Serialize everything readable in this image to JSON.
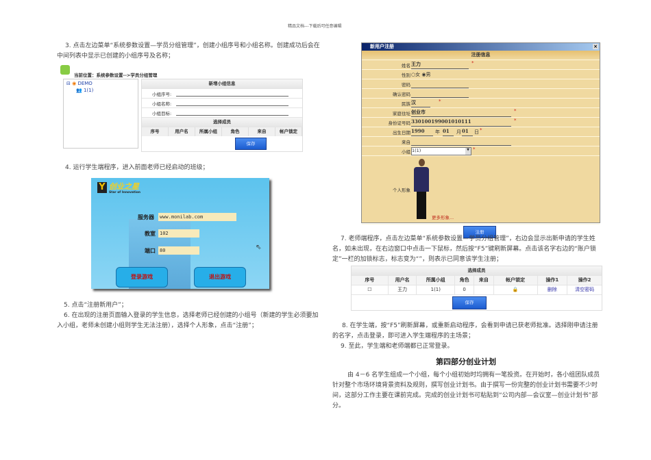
{
  "header": "精品文档---下载后可任意编辑",
  "left": {
    "para3": "3. 点击左边菜单“系统参数设置—学员分组管理”，创建小组序号和小组名称。创建成功后会在中间列表中显示已创建的小组序号及名称；",
    "shot1": {
      "location": "当前位置：系统参数设置-->学员分组管理",
      "tree_root": "DEMO",
      "tree_child": "1(1)",
      "form_title": "新增小组信息",
      "fields": [
        "小组序号:",
        "小组名称:",
        "小组目标:"
      ],
      "members_title": "选择成员",
      "columns": [
        "序号",
        "用户名",
        "所属小组",
        "角色",
        "来自",
        "帐户锁定"
      ],
      "save": "保存"
    },
    "para4": "4. 运行学生端程序，进入前面老师已经启动的班级；",
    "login": {
      "logo_cn": "创业之星",
      "logo_en": "Star of Innovation",
      "server_label": "服务器",
      "server": "www.monilab.com",
      "room_label": "教室",
      "room": "102",
      "port_label": "端口",
      "port": "80",
      "login_btn": "登录游戏",
      "exit_btn": "退出游戏"
    },
    "para5": "5. 点击“注册新用户”；",
    "para6": "6. 在出现的注册页面输入登录的学生信息，选择老师已经创建的小组号（新建的学生必须要加入小组，老师未创建小组则学生无法注册），选择个人形象，点击“注册”；"
  },
  "right": {
    "dialog": {
      "title": "新用户注册",
      "section": "注册信息",
      "name_label": "姓名",
      "name": "王力",
      "gender_label": "性别",
      "female": "女",
      "male": "男",
      "pwd_label": "密码",
      "pwd2_label": "确认密码",
      "ethnic_label": "民族",
      "ethnic": "汉",
      "addr_label": "家庭住址",
      "addr": "创业市",
      "id_label": "身份证号码",
      "id": "330100199001010111",
      "birth_label": "出生日期",
      "year": "1990",
      "year_u": "年",
      "month": "01",
      "month_u": "月",
      "day": "01",
      "day_u": "日",
      "from_label": "来自",
      "group_label": "小组",
      "group": "1(1)",
      "avatar_label": "个人形象",
      "more": "更多形象...",
      "register": "注册"
    },
    "para7": "7. 老师端程序，点击左边菜单“系统参数设置—学员分组管理”，右边会显示出新申请的学生姓名，如未出现，在右边窗口中点击一下鼠标，然后按“F5”键刷新屏幕。点击该名字右边的“账户锁定”一栏的加锁标志，标志变为“”，则表示已同意该学生注册；",
    "table": {
      "title": "选择成员",
      "columns": [
        "序号",
        "用户名",
        "所属小组",
        "角色",
        "来自",
        "帐户锁定",
        "操作1",
        "操作2"
      ],
      "row": {
        "user": "王力",
        "group": "1(1)",
        "role": "0",
        "from": "",
        "op1": "删除",
        "op2": "清空密码"
      },
      "save": "保存"
    },
    "para8": "8. 在学生端，按“F5”刷新屏幕，或重新启动程序，会看到申请已获老师批准。选择刚申请注册的名字，点击登录，即可进入学生端程序的主场景；",
    "para9": "9. 至此，学生端和老师端都已正常登录。",
    "heading": "第四部分创业计划",
    "body": "由 4－6 名学生组成一个小组，每个小组初始时均拥有一笔投资。在开始时，各小组团队成员针对整个市场环境背景资料及规则，撰写创业计划书。由于撰写一份完整的创业计划书需要不少时间，这部分工作主要在课前完成。完成的创业计划书可粘贴到“公司内部—会议室—创业计划书”部分。"
  }
}
